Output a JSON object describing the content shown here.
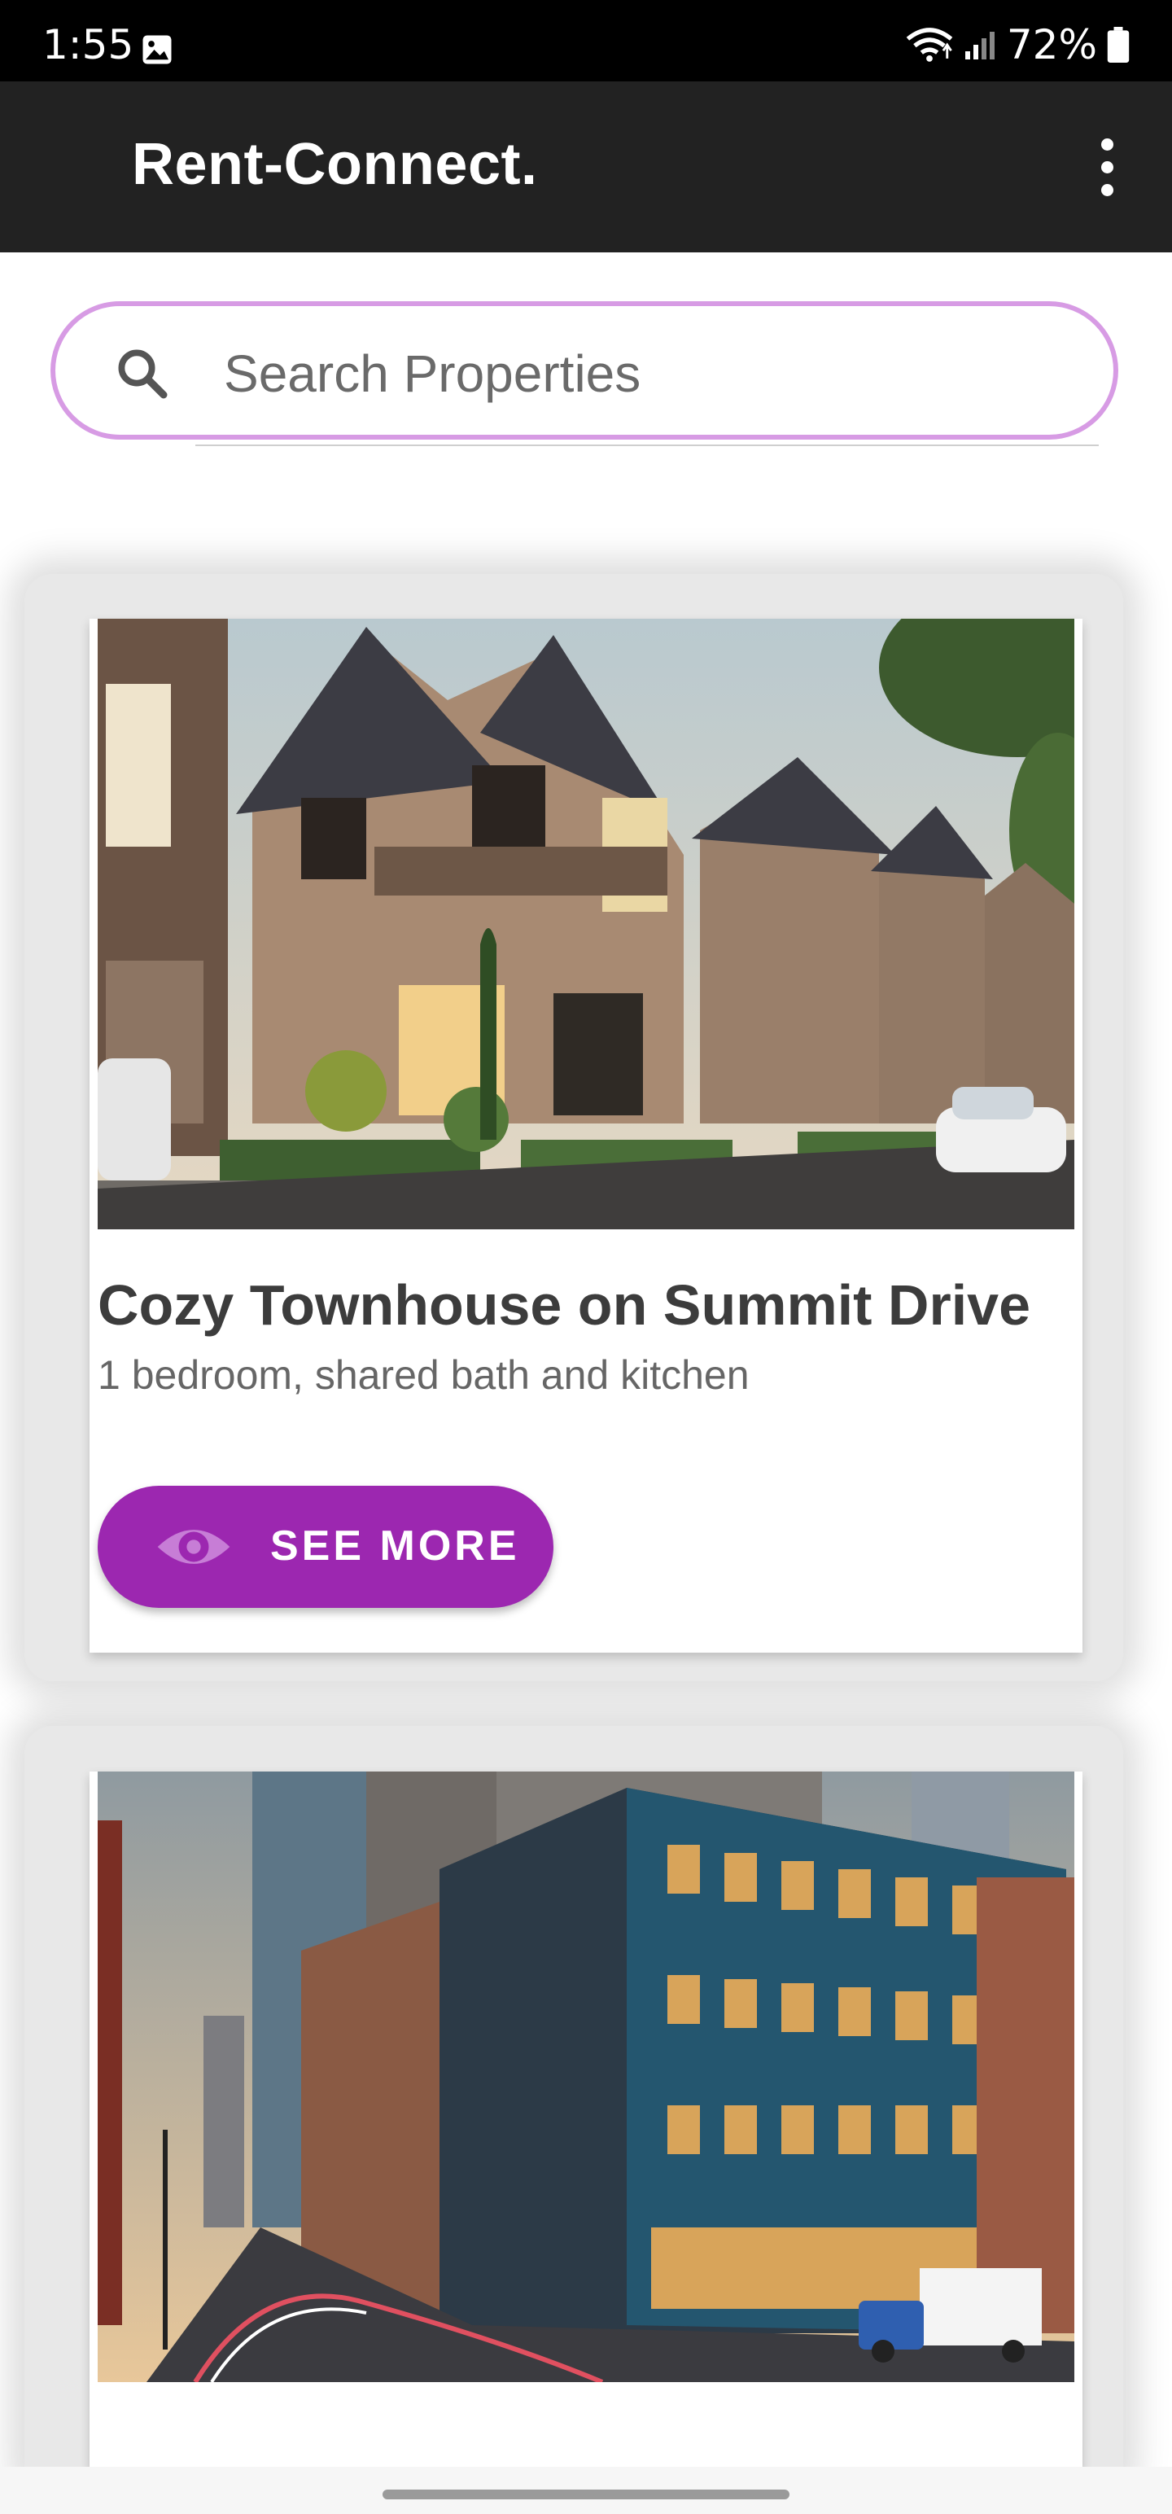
{
  "status_bar": {
    "time": "1:55",
    "battery": "72%",
    "icons": [
      "gallery-icon",
      "wifi-icon",
      "signal-icon",
      "battery-icon"
    ]
  },
  "app_bar": {
    "title": "Rent-Connect.",
    "menu_icon": "more-vert-icon"
  },
  "search": {
    "placeholder": "Search Properties",
    "value": "",
    "icon": "search-icon",
    "border_color": "#d79be4"
  },
  "listings": [
    {
      "image": "townhouse-photo",
      "title": "Cozy Townhouse on Summit Drive",
      "description": "1 bedroom, shared bath and kitchen",
      "button_label": "SEE MORE",
      "button_icon": "eye-icon"
    },
    {
      "image": "apartment-building-photo",
      "title": "",
      "description": "",
      "button_label": "",
      "button_icon": ""
    }
  ],
  "colors": {
    "app_bar": "#222222",
    "accent": "#9c27b0",
    "search_border": "#d79be4"
  }
}
